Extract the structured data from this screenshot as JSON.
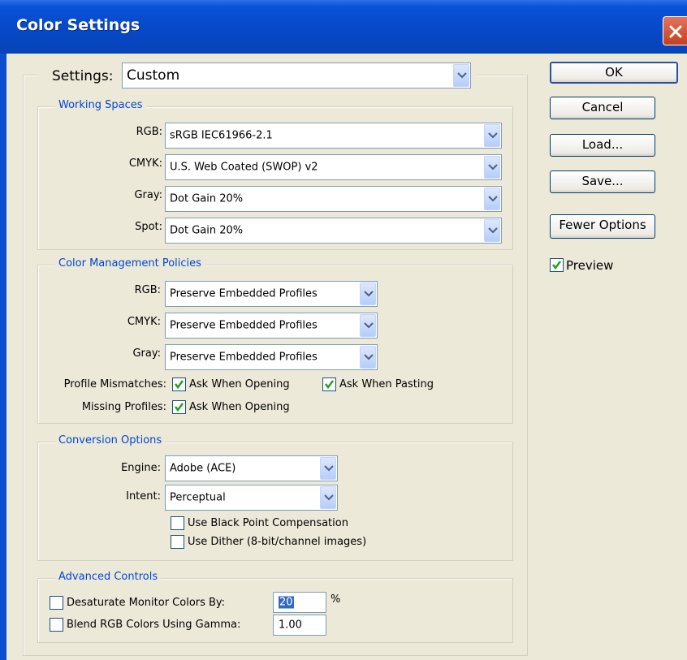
{
  "window": {
    "title": "Color Settings"
  },
  "settings": {
    "label": "Settings:",
    "value": "Custom"
  },
  "working_spaces": {
    "legend": "Working Spaces",
    "rows": [
      {
        "label": "RGB:",
        "value": "sRGB IEC61966-2.1"
      },
      {
        "label": "CMYK:",
        "value": "U.S. Web Coated (SWOP) v2"
      },
      {
        "label": "Gray:",
        "value": "Dot Gain 20%"
      },
      {
        "label": "Spot:",
        "value": "Dot Gain 20%"
      }
    ]
  },
  "policies": {
    "legend": "Color Management Policies",
    "rows": [
      {
        "label": "RGB:",
        "value": "Preserve Embedded Profiles"
      },
      {
        "label": "CMYK:",
        "value": "Preserve Embedded Profiles"
      },
      {
        "label": "Gray:",
        "value": "Preserve Embedded Profiles"
      }
    ],
    "mismatch_label": "Profile Mismatches:",
    "ask_opening": "Ask When Opening",
    "ask_pasting": "Ask When Pasting",
    "missing_label": "Missing Profiles:",
    "missing_ask_opening": "Ask When Opening"
  },
  "conversion": {
    "legend": "Conversion Options",
    "engine_label": "Engine:",
    "engine_value": "Adobe (ACE)",
    "intent_label": "Intent:",
    "intent_value": "Perceptual",
    "black_point": "Use Black Point Compensation",
    "dither": "Use Dither (8-bit/channel images)"
  },
  "advanced": {
    "legend": "Advanced Controls",
    "desaturate_label": "Desaturate Monitor Colors By:",
    "desaturate_value": "20",
    "percent": "%",
    "blend_label": "Blend RGB Colors Using Gamma:",
    "blend_value": "1.00"
  },
  "buttons": {
    "ok": "OK",
    "cancel": "Cancel",
    "load": "Load...",
    "save": "Save...",
    "fewer": "Fewer Options"
  },
  "preview": {
    "label": "Preview",
    "checked": true
  },
  "colors": {
    "title_bar": "#0648c8",
    "legend_text": "#0046d5",
    "dialog_bg": "#ece9d8",
    "check": "#21a121"
  }
}
